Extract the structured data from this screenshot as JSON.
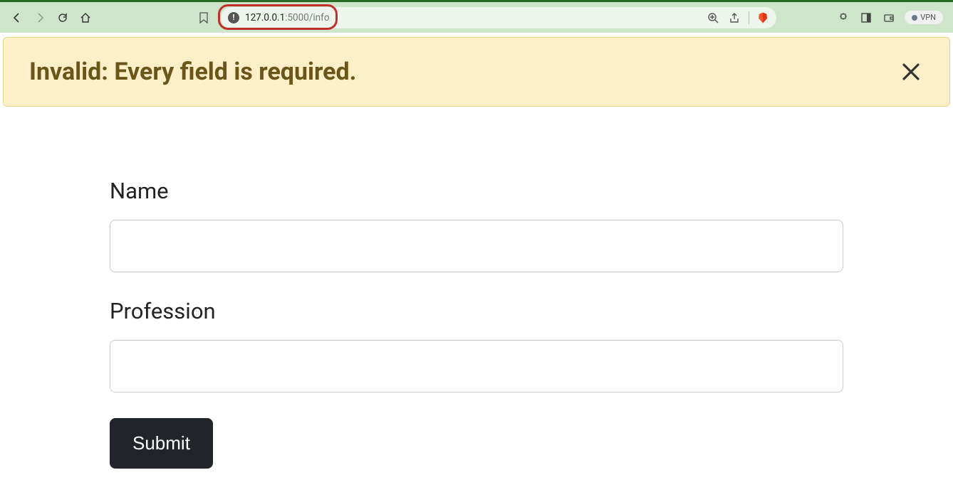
{
  "browser": {
    "url_host": "127.0.0.1",
    "url_path": ":5000/info",
    "vpn_label": "VPN"
  },
  "alert": {
    "message": "Invalid: Every field is required."
  },
  "form": {
    "name_label": "Name",
    "name_value": "",
    "profession_label": "Profession",
    "profession_value": "",
    "submit_label": "Submit"
  }
}
